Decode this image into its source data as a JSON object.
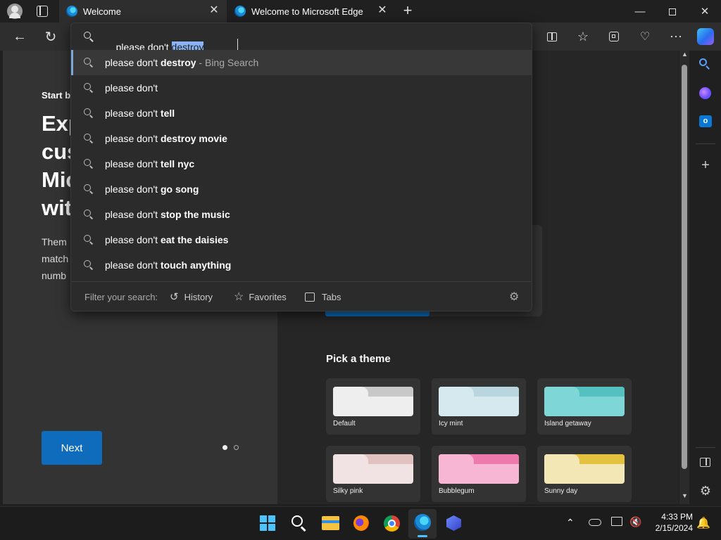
{
  "tabs": [
    {
      "title": "Welcome",
      "active": true
    },
    {
      "title": "Welcome to Microsoft Edge",
      "active": false
    }
  ],
  "omnibox": {
    "typed_prefix": "please don't ",
    "selected_completion": "destroy"
  },
  "suggestions": [
    {
      "prefix": "please don't ",
      "bold": "destroy",
      "suffix": " - Bing Search"
    },
    {
      "prefix": "please don't",
      "bold": "",
      "suffix": ""
    },
    {
      "prefix": "please don't ",
      "bold": "tell",
      "suffix": ""
    },
    {
      "prefix": "please don't ",
      "bold": "destroy movie",
      "suffix": ""
    },
    {
      "prefix": "please don't ",
      "bold": "tell nyc",
      "suffix": ""
    },
    {
      "prefix": "please don't ",
      "bold": "go song",
      "suffix": ""
    },
    {
      "prefix": "please don't ",
      "bold": "stop the music",
      "suffix": ""
    },
    {
      "prefix": "please don't ",
      "bold": "eat the daisies",
      "suffix": ""
    },
    {
      "prefix": "please don't ",
      "bold": "touch anything",
      "suffix": ""
    }
  ],
  "filter": {
    "label": "Filter your search:",
    "history": "History",
    "favorites": "Favorites",
    "tabs": "Tabs"
  },
  "welcome": {
    "start_label": "Start b",
    "heading_lines": [
      "Exp",
      "cus",
      "Mic",
      "wit"
    ],
    "body_lines": [
      "Them",
      "match",
      "numb"
    ],
    "next_button": "Next"
  },
  "themes": {
    "heading": "Pick a theme",
    "items": [
      {
        "name": "Default",
        "color": "#eeeeee",
        "tab": "#c8c8c8"
      },
      {
        "name": "Icy mint",
        "color": "#d6e9ef",
        "tab": "#b9d6df"
      },
      {
        "name": "Island getaway",
        "color": "#7fd6d6",
        "tab": "#54c0c0"
      },
      {
        "name": "Silky pink",
        "color": "#f1e3e3",
        "tab": "#e2c1c1"
      },
      {
        "name": "Bubblegum",
        "color": "#f7b6d4",
        "tab": "#ee79ad"
      },
      {
        "name": "Sunny day",
        "color": "#f3e7b5",
        "tab": "#e4c13f"
      }
    ]
  },
  "clock": {
    "time": "4:33 PM",
    "date": "2/15/2024"
  }
}
